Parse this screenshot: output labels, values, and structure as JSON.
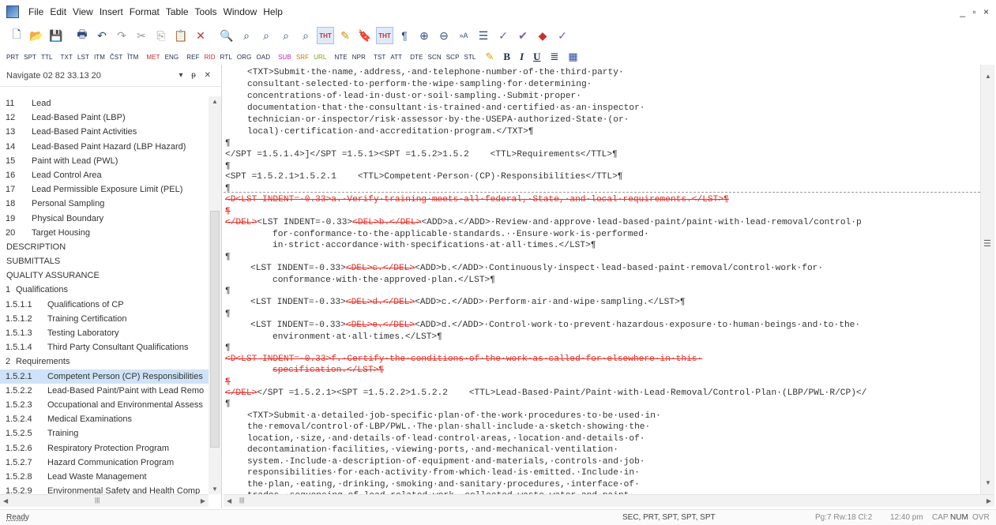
{
  "menu": [
    "File",
    "Edit",
    "View",
    "Insert",
    "Format",
    "Table",
    "Tools",
    "Window",
    "Help"
  ],
  "window_controls": "_ ▫ ×",
  "toolbar1": {
    "icons": [
      "new-document-icon",
      "open-folder-icon",
      "save-icon",
      "print-icon",
      "undo-icon",
      "redo-icon",
      "cut-icon",
      "copy-icon",
      "paste-icon",
      "delete-icon",
      "find-icon",
      "find-next-icon",
      "find-replace-icon",
      "find-tag-icon",
      "find-all-icon",
      "tht-icon",
      "spell-check-icon",
      "bookmark-icon",
      "tht-format-icon",
      "paragraph-mark-icon",
      "zoom-in-icon",
      "zoom-out-icon",
      "font-size-icon",
      "align-icon",
      "spelling-icon",
      "check-icon",
      "arrow-icon",
      "thesaurus-icon"
    ],
    "tht_label": "THT",
    "tht2_label": "THT"
  },
  "toolbar2": {
    "tags": [
      "PRT",
      "SPT",
      "TTL",
      "TXT",
      "LST",
      "ITM",
      "ČST",
      "ĨTM",
      "MET",
      "ENG",
      "REF",
      "RID",
      "RTL",
      "ORG",
      "OAD",
      "SUB",
      "SRF",
      "URL",
      "NTE",
      "NPR",
      "TST",
      "ATT",
      "DTE",
      "SCN",
      "SCP",
      "STL"
    ],
    "bold": "B",
    "italic": "I",
    "underline": "U"
  },
  "navigator": {
    "title": "Navigate 02 82 33.13 20",
    "controls": "▾ ᵽ ✕",
    "items": [
      {
        "num": "11",
        "label": "Lead"
      },
      {
        "num": "12",
        "label": "Lead-Based Paint (LBP)"
      },
      {
        "num": "13",
        "label": "Lead-Based Paint Activities"
      },
      {
        "num": "14",
        "label": "Lead-Based Paint Hazard (LBP Hazard)"
      },
      {
        "num": "15",
        "label": "Paint with Lead (PWL)"
      },
      {
        "num": "16",
        "label": "Lead Control Area"
      },
      {
        "num": "17",
        "label": "Lead Permissible Exposure Limit (PEL)"
      },
      {
        "num": "18",
        "label": "Personal Sampling"
      },
      {
        "num": "19",
        "label": "Physical Boundary"
      },
      {
        "num": "20",
        "label": "Target Housing"
      },
      {
        "num": "",
        "label": "DESCRIPTION"
      },
      {
        "num": "",
        "label": "SUBMITTALS"
      },
      {
        "num": "",
        "label": "QUALITY ASSURANCE"
      },
      {
        "num": "1",
        "label": "Qualifications"
      },
      {
        "num": "1.5.1.1",
        "label": "Qualifications of CP"
      },
      {
        "num": "1.5.1.2",
        "label": "Training Certification"
      },
      {
        "num": "1.5.1.3",
        "label": "Testing Laboratory"
      },
      {
        "num": "1.5.1.4",
        "label": "Third Party Consultant Qualifications"
      },
      {
        "num": "2",
        "label": "Requirements"
      },
      {
        "num": "1.5.2.1",
        "label": "Competent Person (CP) Responsibilities"
      },
      {
        "num": "1.5.2.2",
        "label": "Lead-Based Paint/Paint with Lead Remo"
      },
      {
        "num": "1.5.2.3",
        "label": "Occupational and Environmental Assess"
      },
      {
        "num": "1.5.2.4",
        "label": "Medical Examinations"
      },
      {
        "num": "1.5.2.5",
        "label": "Training"
      },
      {
        "num": "1.5.2.6",
        "label": "Respiratory Protection Program"
      },
      {
        "num": "1.5.2.7",
        "label": "Hazard Communication Program"
      },
      {
        "num": "1.5.2.8",
        "label": "Lead Waste Management"
      },
      {
        "num": "1.5.2.9",
        "label": "Environmental Safety and Health Comp"
      }
    ]
  },
  "editor": {
    "lines": [
      "<TXT>Submit·the·name,·address,·and·telephone·number·of·the·third·party·",
      "consultant·selected·to·perform·the·wipe·sampling·for·determining·",
      "concentrations·of·lead·in·dust·or·soil·sampling.·Submit·proper·",
      "documentation·that·the·consultant·is·trained·and·certified·as·an·inspector·",
      "technician·or·inspector/risk·assessor·by·the·USEPA·authorized·State·(or·",
      "local)·certification·and·accreditation·program.</TXT>¶",
      "¶",
      "</SPT =1.5.1.4>]</SPT =1.5.1><SPT =1.5.2>1.5.2    <TTL>Requirements</TTL>¶",
      "¶",
      "<SPT =1.5.2.1>1.5.2.1    <TTL>Competent·Person·(CP)·Responsibilities</TTL>¶",
      "¶",
      "<D<LST INDENT=-0.33>a.·Verify·training·meets·all·federal,·State,·and·local·requirements.</LST>¶",
      "¶",
      "</DEL>",
      "<LST INDENT=-0.33>",
      "<DEL>b.</DEL>",
      "<ADD>a.</ADD>",
      "·Review·and·approve·lead-based·paint/paint·with·lead·removal/control·p",
      "for·conformance·to·the·applicable·standards.··Ensure·work·is·performed·",
      "in·strict·accordance·with·specifications·at·all·times.</LST>¶",
      "¶",
      "<LST INDENT=-0.33>",
      "<DEL>c.</DEL>",
      "<ADD>b.</ADD>",
      "·Continuously·inspect·lead-based·paint·removal/control·work·for·",
      "conformance·with·the·approved·plan.</LST>¶",
      "¶",
      "<LST INDENT=-0.33>",
      "<DEL>d.</DEL>",
      "<ADD>c.</ADD>",
      "·Perform·air·and·wipe·sampling.</LST>¶",
      "¶",
      "<LST INDENT=-0.33>",
      "<DEL>e.</DEL>",
      "<ADD>d.</ADD>",
      "·Control·work·to·prevent·hazardous·exposure·to·human·beings·and·to·the·",
      "environment·at·all·times.</LST>¶",
      "¶",
      "<D<LST INDENT=-0.33>f.·Certify·the·conditions·of·the·work·as·called·for·elsewhere·in·this·",
      "specification.</LST>¶",
      "¶",
      "</DEL>",
      "</SPT =1.5.2.1><SPT =1.5.2.2>1.5.2.2    <TTL>Lead-Based·Paint/Paint·with·Lead·Removal/Control·Plan·(LBP/PWL·R/CP)</",
      "¶",
      "<TXT>Submit·a·detailed·job-specific·plan·of·the·work·procedures·to·be·used·in·",
      "the·removal/control·of·LBP/PWL.·The·plan·shall·include·a·sketch·showing·the·",
      "location,·size,·and·details·of·lead·control·areas,·location·and·details·of·",
      "decontamination·facilities,·viewing·ports,·and·mechanical·ventilation·",
      "system.·Include·a·description·of·equipment·and·materials,·controls·and·job·",
      "responsibilities·for·each·activity·from·which·lead·is·emitted.·Include·in·",
      "the·plan,·eating,·drinking,·smoking·and·sanitary·procedures,·interface·of·",
      "trades,·sequencing·of·lead·related·work,·collected·waste·water·and·paint·"
    ]
  },
  "status": {
    "ready": "Ready",
    "tags": "SEC, PRT, SPT, SPT, SPT",
    "position": "Pg:7 Rw:18 Cl:2",
    "time": "12:40 pm",
    "cap": "CAP",
    "num": "NUM",
    "ovr": "OVR"
  },
  "colors": {
    "deleted": "#e2302a",
    "selected_nav": "#cfe3f8"
  }
}
